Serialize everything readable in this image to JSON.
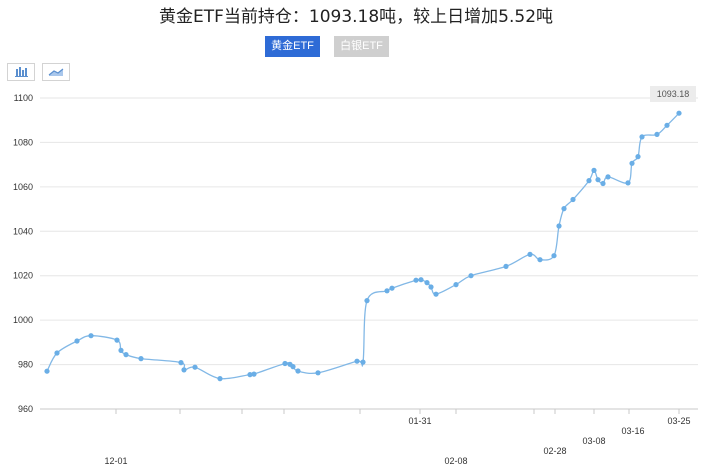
{
  "title": "黄金ETF当前持仓：1093.18吨，较上日增加5.52吨",
  "tabs": {
    "gold": "黄金ETF",
    "silver": "白银ETF"
  },
  "toolbar": {
    "bar_icon": "bar-chart-icon",
    "line_icon": "line-chart-icon"
  },
  "colors": {
    "line": "#82b8e6",
    "point": "#6aaee6",
    "active_tab": "#2e6bd6",
    "inactive_tab": "#cfcfcf"
  },
  "chart_data": {
    "type": "line",
    "title": "黄金ETF当前持仓：1093.18吨，较上日增加5.52吨",
    "ylim": [
      960,
      1100
    ],
    "y_ticks": [
      960,
      980,
      1000,
      1020,
      1040,
      1060,
      1080,
      1100
    ],
    "x_tick_labels": [
      "12-01",
      "01-31",
      "02-08",
      "02-28",
      "03-08",
      "03-16",
      "03-25"
    ],
    "last_value_label": "1093.18",
    "grid": true,
    "series": [
      {
        "values": [
          977.0,
          985.2,
          990.6,
          993.0,
          991.0,
          986.4,
          984.5,
          982.7,
          980.9,
          977.6,
          978.8,
          973.7,
          975.5,
          975.7,
          980.5,
          980.1,
          979.1,
          977.1,
          976.3,
          981.5,
          981.1,
          1008.8,
          1013.2,
          1014.4,
          1018.0,
          1018.2,
          1016.9,
          1014.9,
          1011.7,
          1016.0,
          1020.0,
          1024.2,
          1029.6,
          1027.2,
          1029.0,
          1042.4,
          1050.2,
          1054.3,
          1062.8,
          1067.4,
          1063.2,
          1061.5,
          1064.5,
          1061.8,
          1070.6,
          1073.6,
          1082.5,
          1083.6,
          1087.7,
          1093.18
        ]
      }
    ]
  }
}
